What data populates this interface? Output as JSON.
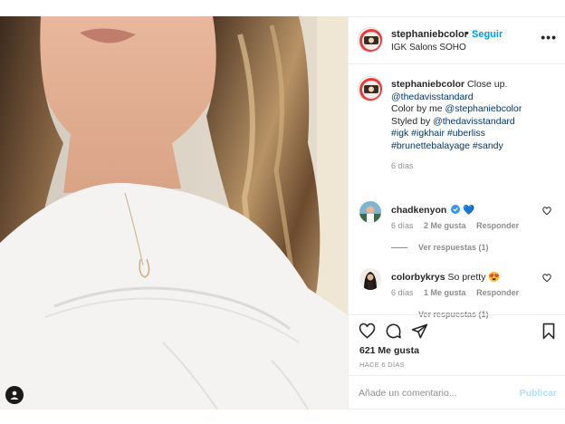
{
  "post": {
    "username": "stephaniebcolor",
    "separator": "•",
    "follow_label": "Seguir",
    "location": "IGK Salons SOHO",
    "more_label": "•••"
  },
  "caption": {
    "username": "stephaniebcolor",
    "line1_text": " Close up.",
    "line2_mention": "@thedavisstandard",
    "line3_prefix": "Color by me ",
    "line3_mention": "@stephaniebcolor",
    "line4_prefix": "Styled by ",
    "line4_mention": "@thedavisstandard",
    "line5_tags": "#igk #igkhair #uberliss",
    "line6_tags": "#brunettebalayage #sandy",
    "time": "6 días"
  },
  "comments": [
    {
      "username": "chadkenyon",
      "text": "💙",
      "time": "6 días",
      "likes": "2 Me gusta",
      "reply_label": "Responder",
      "view_replies": "Ver respuestas (1)"
    },
    {
      "username": "colorbykrys",
      "text": "So pretty 😍",
      "time": "6 días",
      "likes": "1 Me gusta",
      "reply_label": "Responder",
      "view_replies": "Ver respuestas (1)"
    }
  ],
  "stats": {
    "likes": "621 Me gusta",
    "posted_ago": "HACE 6 DÍAS"
  },
  "add_comment": {
    "placeholder": "Añade un comentario...",
    "post_label": "Publicar"
  },
  "icons": {
    "like": "heart-icon",
    "comment": "comment-icon",
    "share": "paper-plane-icon",
    "save": "bookmark-icon",
    "user_tag": "user-tag-icon",
    "verified": "verified-badge-icon"
  },
  "colors": {
    "link": "#00376b",
    "accent": "#0095f6",
    "muted": "#8e8e8e",
    "post_disabled": "#b2dffc"
  }
}
